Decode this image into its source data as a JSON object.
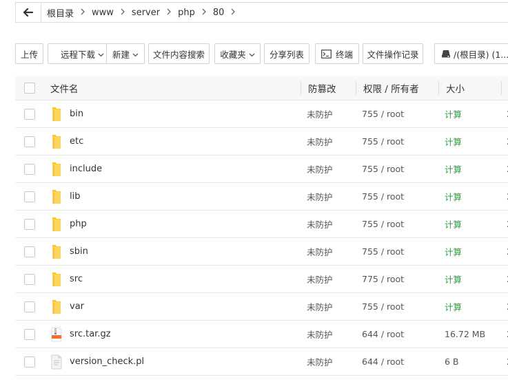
{
  "breadcrumb": {
    "back_icon": "arrow-left-icon",
    "items": [
      "根目录",
      "www",
      "server",
      "php",
      "80"
    ],
    "separator": ">"
  },
  "toolbar": {
    "upload": "上传",
    "remote_download": "远程下载",
    "create": "新建",
    "content_search": "文件内容搜索",
    "favorites": "收藏夹",
    "share_list": "分享列表",
    "terminal": "终端",
    "operation_log": "文件操作记录",
    "disk": "/(根目录) (1..."
  },
  "table": {
    "headers": {
      "name": "文件名",
      "protect": "防篡改",
      "perm_owner": "权限 / 所有者",
      "size": "大小"
    },
    "rows": [
      {
        "type": "folder",
        "name": "bin",
        "protect": "未防护",
        "perm": "755 / root",
        "size": "计算",
        "calc": true,
        "edge": "2"
      },
      {
        "type": "folder",
        "name": "etc",
        "protect": "未防护",
        "perm": "755 / root",
        "size": "计算",
        "calc": true,
        "edge": "2"
      },
      {
        "type": "folder",
        "name": "include",
        "protect": "未防护",
        "perm": "755 / root",
        "size": "计算",
        "calc": true,
        "edge": "2"
      },
      {
        "type": "folder",
        "name": "lib",
        "protect": "未防护",
        "perm": "755 / root",
        "size": "计算",
        "calc": true,
        "edge": "2"
      },
      {
        "type": "folder",
        "name": "php",
        "protect": "未防护",
        "perm": "755 / root",
        "size": "计算",
        "calc": true,
        "edge": "2"
      },
      {
        "type": "folder",
        "name": "sbin",
        "protect": "未防护",
        "perm": "755 / root",
        "size": "计算",
        "calc": true,
        "edge": "2"
      },
      {
        "type": "folder",
        "name": "src",
        "protect": "未防护",
        "perm": "775 / root",
        "size": "计算",
        "calc": true,
        "edge": "2"
      },
      {
        "type": "folder",
        "name": "var",
        "protect": "未防护",
        "perm": "755 / root",
        "size": "计算",
        "calc": true,
        "edge": "2"
      },
      {
        "type": "archive",
        "name": "src.tar.gz",
        "protect": "未防护",
        "perm": "644 / root",
        "size": "16.72 MB",
        "calc": false,
        "edge": "2"
      },
      {
        "type": "file",
        "name": "version_check.pl",
        "protect": "未防护",
        "perm": "644 / root",
        "size": "6 B",
        "calc": false,
        "edge": "2"
      }
    ]
  },
  "colors": {
    "folder": "#f7c534",
    "accent_green": "#20a53a",
    "archive_orange": "#ff6a2b"
  }
}
